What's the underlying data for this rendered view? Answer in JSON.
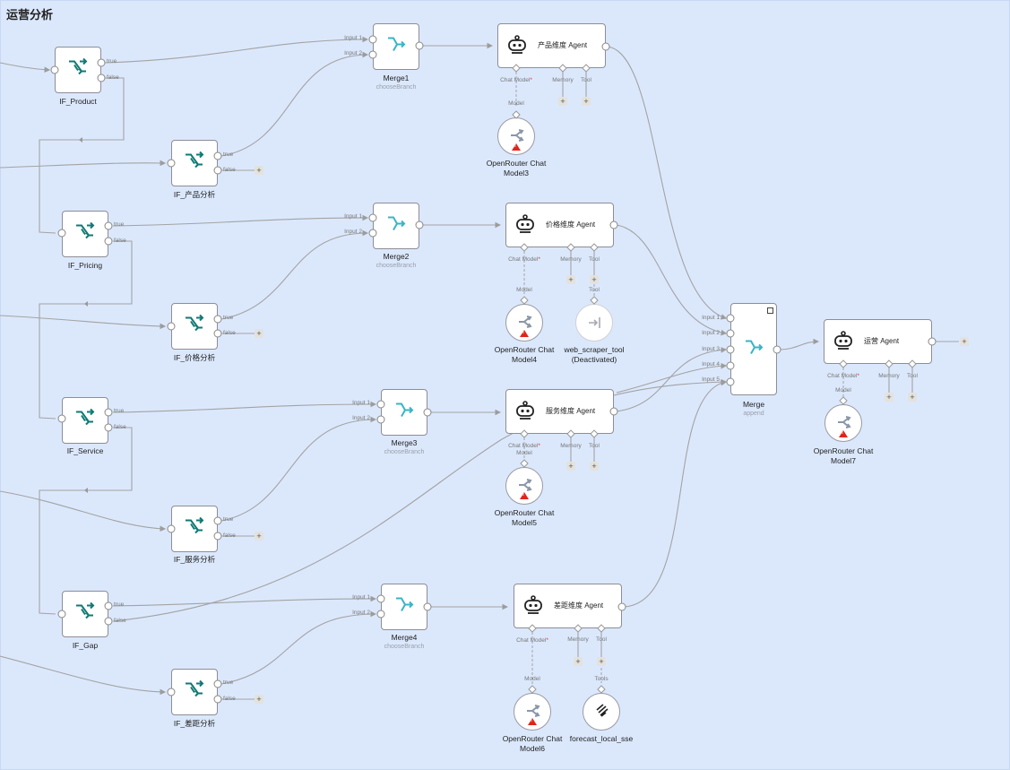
{
  "section": {
    "title": "运营分析"
  },
  "labels": {
    "true": "true",
    "false": "false",
    "input1": "Input 1",
    "input2": "Input 2",
    "input3": "Input 3",
    "input4": "Input 4",
    "input5": "Input 5",
    "chat_model": "Chat Model",
    "memory": "Memory",
    "tool": "Tool",
    "model": "Model",
    "tools": "Tools",
    "plus": "+"
  },
  "nodes": {
    "if_product": {
      "name": "IF_Product"
    },
    "if_product_analysis": {
      "name": "IF_产品分析"
    },
    "if_pricing": {
      "name": "IF_Pricing"
    },
    "if_price_analysis": {
      "name": "IF_价格分析"
    },
    "if_service": {
      "name": "IF_Service"
    },
    "if_service_analysis": {
      "name": "IF_服务分析"
    },
    "if_gap": {
      "name": "IF_Gap"
    },
    "if_gap_analysis": {
      "name": "IF_差距分析"
    },
    "merge1": {
      "name": "Merge1",
      "mode": "chooseBranch"
    },
    "merge2": {
      "name": "Merge2",
      "mode": "chooseBranch"
    },
    "merge3": {
      "name": "Merge3",
      "mode": "chooseBranch"
    },
    "merge4": {
      "name": "Merge4",
      "mode": "chooseBranch"
    },
    "merge": {
      "name": "Merge",
      "mode": "append"
    },
    "agent_product": {
      "name": "产品维度 Agent"
    },
    "agent_price": {
      "name": "价格维度 Agent"
    },
    "agent_service": {
      "name": "服务维度 Agent"
    },
    "agent_gap": {
      "name": "差距维度 Agent"
    },
    "agent_ops": {
      "name": "运营 Agent"
    },
    "model3": {
      "line1": "OpenRouter Chat",
      "line2": "Model3"
    },
    "model4": {
      "line1": "OpenRouter Chat",
      "line2": "Model4"
    },
    "model5": {
      "line1": "OpenRouter Chat",
      "line2": "Model5"
    },
    "model6": {
      "line1": "OpenRouter Chat",
      "line2": "Model6"
    },
    "model7": {
      "line1": "OpenRouter Chat",
      "line2": "Model7"
    },
    "web_scraper": {
      "line1": "web_scraper_tool",
      "line2": "(Deactivated)"
    },
    "forecast": {
      "line1": "forecast_local_sse"
    }
  },
  "colors": {
    "canvas": "#dbe8fc",
    "if_icon": "#0f7a74",
    "merge_icon": "#39b4c7",
    "warning": "#e1251b"
  }
}
